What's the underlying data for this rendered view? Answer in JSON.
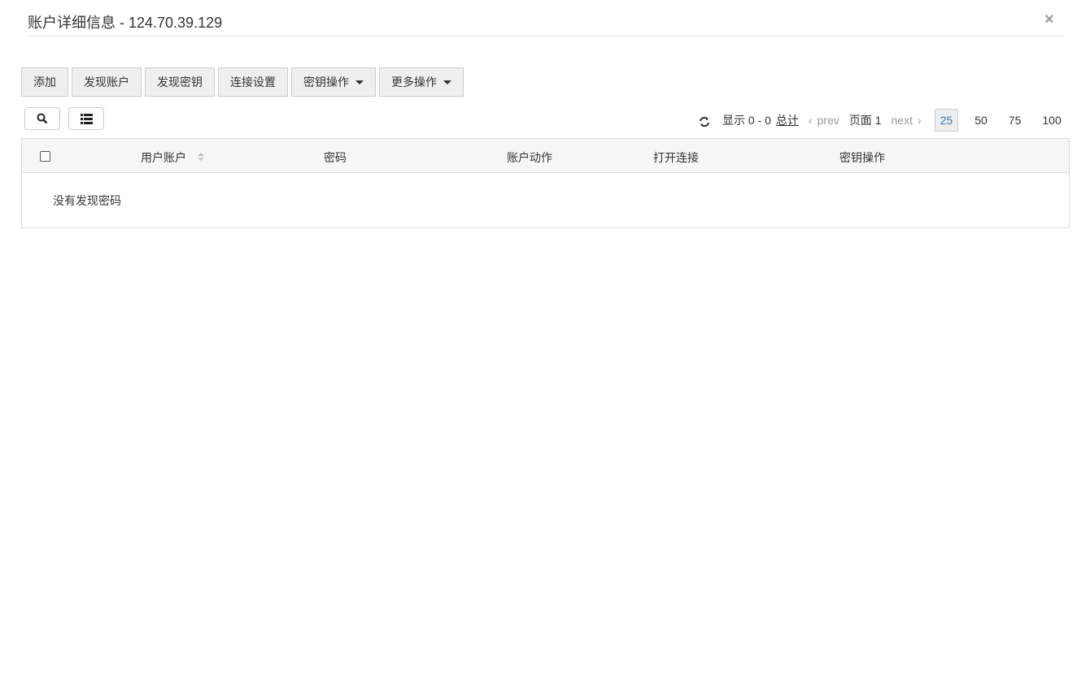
{
  "dialog": {
    "title": "账户详细信息 - 124.70.39.129",
    "close": "×"
  },
  "toolbar": {
    "add": "添加",
    "discover_accounts": "发现账户",
    "discover_keys": "发现密钥",
    "connection_settings": "连接设置",
    "key_ops": "密钥操作",
    "more_ops": "更多操作"
  },
  "pager": {
    "showing": "显示 0 - 0",
    "total": "总计",
    "prev": "prev",
    "page": "页面 1",
    "next": "next",
    "sizes": [
      "25",
      "50",
      "75",
      "100"
    ],
    "active_size": "25"
  },
  "table": {
    "columns": [
      "用户账户",
      "密码",
      "账户动作",
      "打开连接",
      "密钥操作"
    ],
    "empty": "没有发现密码"
  }
}
